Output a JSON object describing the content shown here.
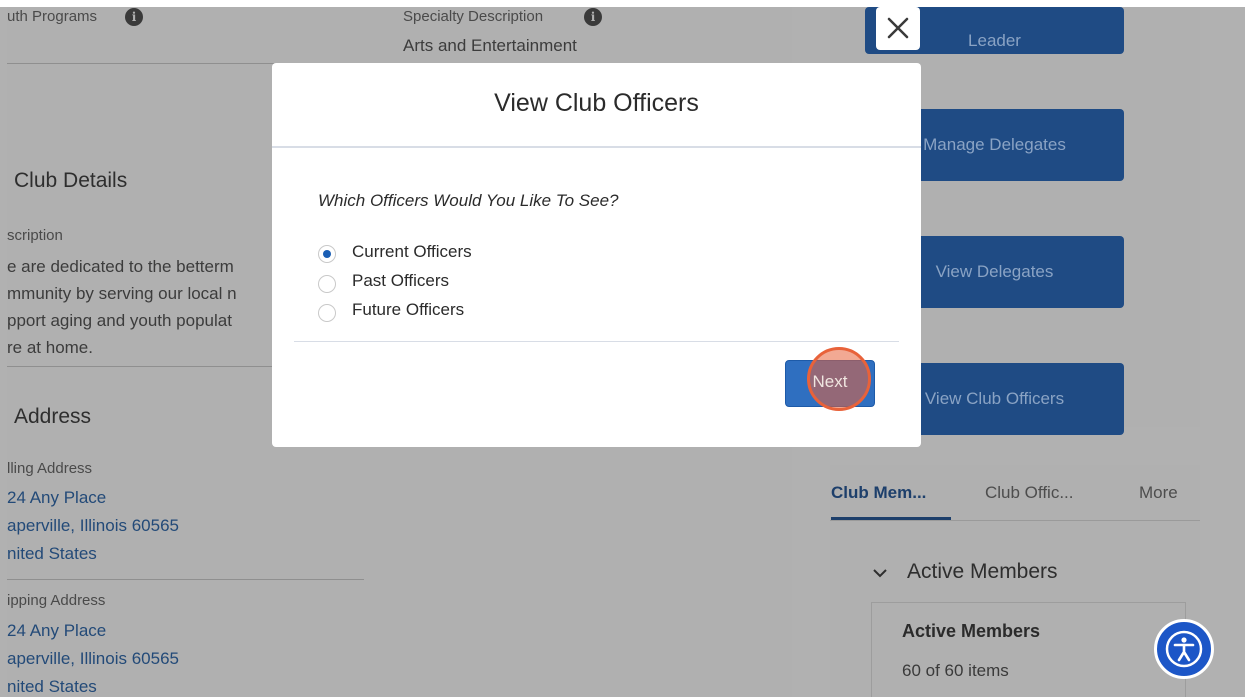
{
  "background": {
    "youth_programs_label": "uth Programs",
    "specialty_description_label": "Specialty Description",
    "specialty_description_value": "Arts and Entertainment",
    "club_details_heading": "Club Details",
    "description_label": "scription",
    "description_lines": [
      "e are dedicated to the betterm",
      "mmunity by serving our local n",
      "pport aging and youth populat",
      "re at home."
    ],
    "address_heading": "Address",
    "billing_label": "lling Address",
    "billing_lines": [
      "24 Any Place",
      "aperville, Illinois 60565",
      "nited States"
    ],
    "shipping_label": "ipping Address",
    "shipping_lines": [
      "24 Any Place",
      "aperville, Illinois 60565",
      "nited States"
    ]
  },
  "right_actions": {
    "leader_label": "Leader",
    "manage_delegates_label": "Manage Delegates",
    "view_delegates_label": "View Delegates",
    "view_club_officers_label": "View Club Officers"
  },
  "related_tabs": {
    "tabs": [
      "Club Mem...",
      "Club Offic...",
      "More"
    ],
    "section_title": "Active Members",
    "card_title": "Active Members",
    "card_count": "60 of 60 items"
  },
  "modal": {
    "title": "View Club Officers",
    "question": "Which Officers Would You Like To See?",
    "options": [
      {
        "label": "Current Officers",
        "checked": true
      },
      {
        "label": "Past Officers",
        "checked": false
      },
      {
        "label": "Future Officers",
        "checked": false
      }
    ],
    "next_label": "Next",
    "close_symbol": "×"
  },
  "colors": {
    "accent_blue": "#1b5fb5",
    "click_highlight": "#e8623a",
    "accessibility_blue": "#1c56c7"
  },
  "icons": {
    "info": "info-icon",
    "close": "close-icon",
    "chevron": "chevron-down-icon",
    "accessibility": "accessibility-icon"
  }
}
